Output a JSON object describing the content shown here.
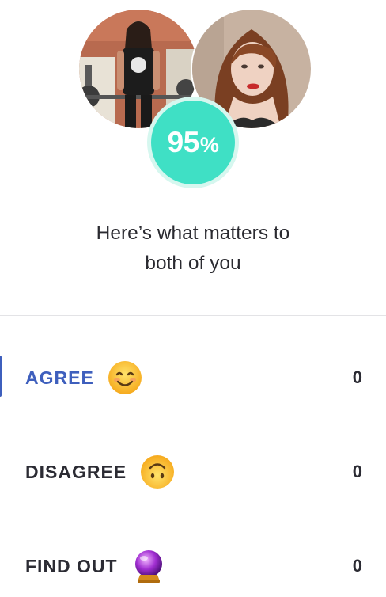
{
  "match": {
    "percent_value": "95",
    "percent_sign": "%"
  },
  "avatars": [
    {
      "name": "user-photo",
      "icon": "profile-photo-gym"
    },
    {
      "name": "match-photo",
      "icon": "profile-photo-portrait"
    }
  ],
  "headline": {
    "line1": "Here’s what matters to",
    "line2": "both of you"
  },
  "categories": [
    {
      "label": "AGREE",
      "icon": "smiling-face-icon",
      "count": "0",
      "active": true
    },
    {
      "label": "DISAGREE",
      "icon": "upside-down-face-icon",
      "count": "0",
      "active": false
    },
    {
      "label": "FIND OUT",
      "icon": "crystal-ball-icon",
      "count": "0",
      "active": false
    }
  ],
  "colors": {
    "accent": "#3e5fbd",
    "match_badge": "#3fe0c5",
    "text": "#2b2b33"
  }
}
